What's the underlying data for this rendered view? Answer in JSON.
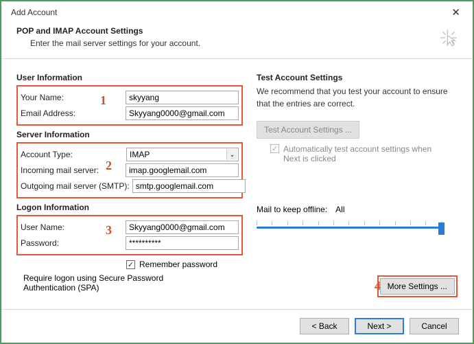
{
  "window": {
    "title": "Add Account"
  },
  "header": {
    "title": "POP and IMAP Account Settings",
    "subtitle": "Enter the mail server settings for your account."
  },
  "annotations": {
    "one": "1",
    "two": "2",
    "three": "3",
    "four": "4"
  },
  "left": {
    "user_info": {
      "title": "User Information",
      "name_label": "Your Name:",
      "name_value": "skyyang",
      "email_label": "Email Address:",
      "email_value": "Skyyang0000@gmail.com"
    },
    "server_info": {
      "title": "Server Information",
      "account_type_label": "Account Type:",
      "account_type_value": "IMAP",
      "incoming_label": "Incoming mail server:",
      "incoming_value": "imap.googlemail.com",
      "outgoing_label": "Outgoing mail server (SMTP):",
      "outgoing_value": "smtp.googlemail.com"
    },
    "logon_info": {
      "title": "Logon Information",
      "username_label": "User Name:",
      "username_value": "Skyyang0000@gmail.com",
      "password_label": "Password:",
      "password_value": "**********",
      "remember_label": "Remember password"
    },
    "spa_label": "Require logon using Secure Password Authentication (SPA)"
  },
  "right": {
    "title": "Test Account Settings",
    "desc": "We recommend that you test your account to ensure that the entries are correct.",
    "test_btn": "Test Account Settings ...",
    "auto_test_label": "Automatically test account settings when Next is clicked",
    "mail_keep_label": "Mail to keep offline:",
    "mail_keep_value": "All",
    "more_settings": "More Settings ..."
  },
  "footer": {
    "back": "< Back",
    "next": "Next >",
    "cancel": "Cancel"
  }
}
